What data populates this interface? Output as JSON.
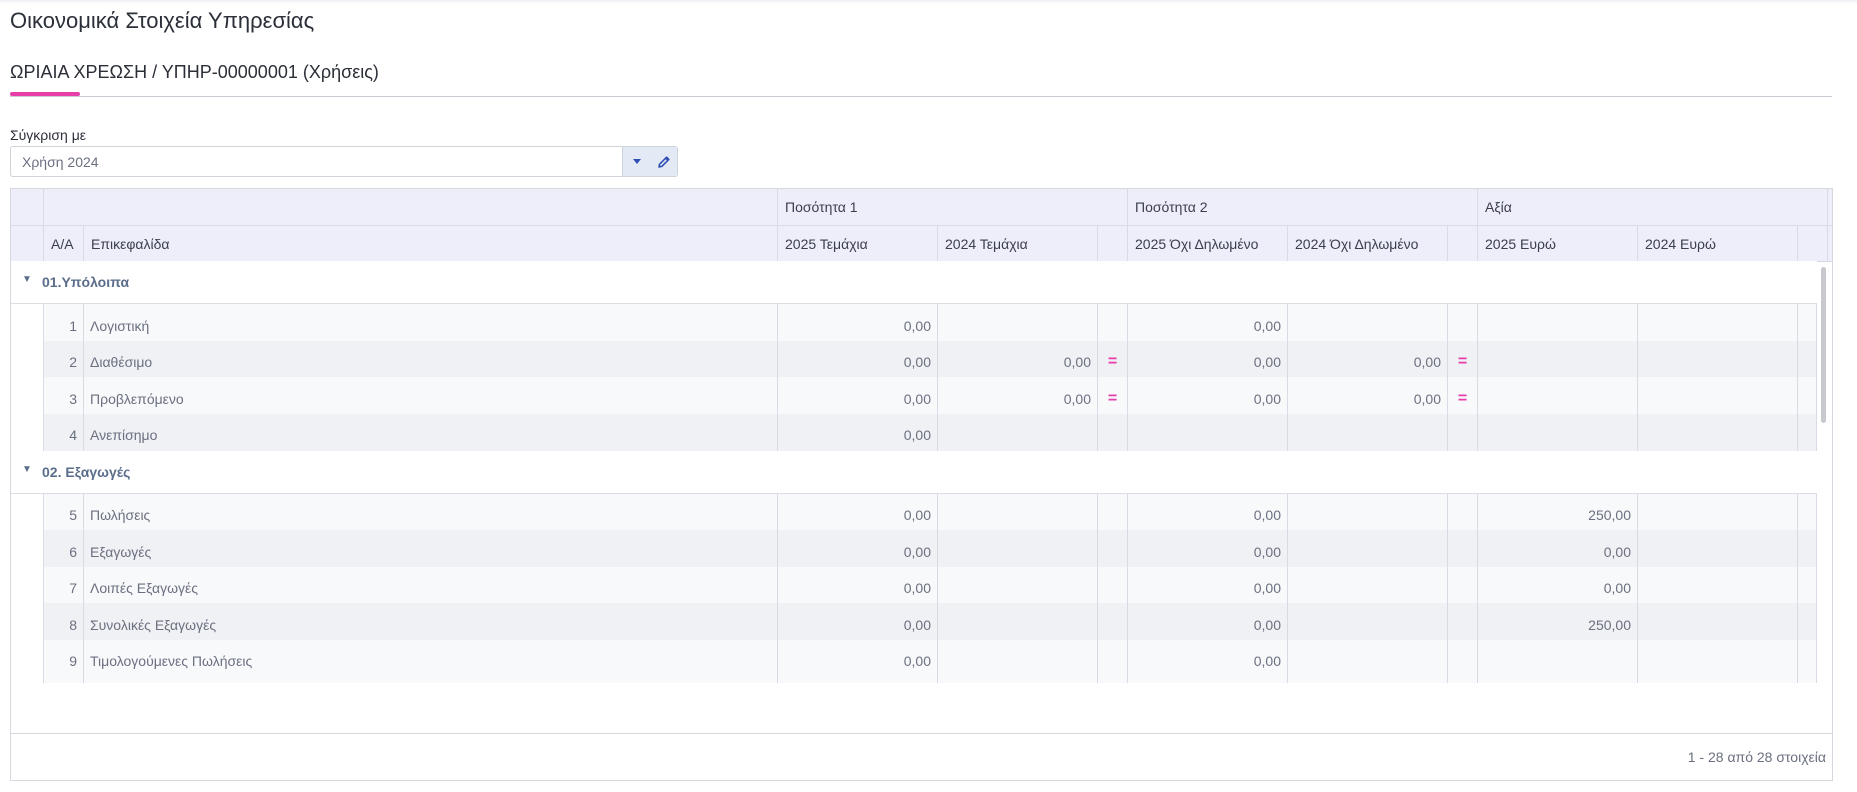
{
  "page": {
    "title": "Οικονομικά Στοιχεία Υπηρεσίας"
  },
  "tab": {
    "label": "ΩΡΙΑΙΑ ΧΡΕΩΣΗ / ΥΠΗΡ-00000001 (Χρήσεις)"
  },
  "compare": {
    "label": "Σύγκριση με",
    "value": "Χρήση 2024",
    "dropdown_icon": "caret-down-icon",
    "edit_icon": "pencil-icon"
  },
  "colors": {
    "accent": "#e73ea9",
    "header_bg": "#eeeefb",
    "link_blue": "#2f4fb3"
  },
  "grid": {
    "group_headers": {
      "g1": "Ποσότητα 1",
      "g2": "Ποσότητα 2",
      "g3": "Αξία"
    },
    "columns": {
      "aa": "Α/Α",
      "title": "Επικεφαλίδα",
      "q1_2025": "2025 Τεμάχια",
      "q1_2024": "2024 Τεμάχια",
      "q2_2025": "2025 Όχι Δηλωμένο",
      "q2_2024": "2024 Όχι Δηλωμένο",
      "v_2025": "2025 Ευρώ",
      "v_2024": "2024 Ευρώ"
    },
    "groups": [
      {
        "label": "01.Υπόλοιπα",
        "rows": [
          {
            "aa": "1",
            "title": "Λογιστική",
            "q1_2025": "0,00",
            "q1_2024": "",
            "eq1": "",
            "q2_2025": "0,00",
            "q2_2024": "",
            "eq2": "",
            "v_2025": "",
            "v_2024": ""
          },
          {
            "aa": "2",
            "title": "Διαθέσιμο",
            "q1_2025": "0,00",
            "q1_2024": "0,00",
            "eq1": "=",
            "q2_2025": "0,00",
            "q2_2024": "0,00",
            "eq2": "=",
            "v_2025": "",
            "v_2024": ""
          },
          {
            "aa": "3",
            "title": "Προβλεπόμενο",
            "q1_2025": "0,00",
            "q1_2024": "0,00",
            "eq1": "=",
            "q2_2025": "0,00",
            "q2_2024": "0,00",
            "eq2": "=",
            "v_2025": "",
            "v_2024": ""
          },
          {
            "aa": "4",
            "title": "Ανεπίσημο",
            "q1_2025": "0,00",
            "q1_2024": "",
            "eq1": "",
            "q2_2025": "",
            "q2_2024": "",
            "eq2": "",
            "v_2025": "",
            "v_2024": ""
          }
        ]
      },
      {
        "label": "02. Εξαγωγές",
        "rows": [
          {
            "aa": "5",
            "title": "Πωλήσεις",
            "q1_2025": "0,00",
            "q1_2024": "",
            "eq1": "",
            "q2_2025": "0,00",
            "q2_2024": "",
            "eq2": "",
            "v_2025": "250,00",
            "v_2024": ""
          },
          {
            "aa": "6",
            "title": "Εξαγωγές",
            "q1_2025": "0,00",
            "q1_2024": "",
            "eq1": "",
            "q2_2025": "0,00",
            "q2_2024": "",
            "eq2": "",
            "v_2025": "0,00",
            "v_2024": ""
          },
          {
            "aa": "7",
            "title": "Λοιπές Εξαγωγές",
            "q1_2025": "0,00",
            "q1_2024": "",
            "eq1": "",
            "q2_2025": "0,00",
            "q2_2024": "",
            "eq2": "",
            "v_2025": "0,00",
            "v_2024": ""
          },
          {
            "aa": "8",
            "title": "Συνολικές Εξαγωγές",
            "q1_2025": "0,00",
            "q1_2024": "",
            "eq1": "",
            "q2_2025": "0,00",
            "q2_2024": "",
            "eq2": "",
            "v_2025": "250,00",
            "v_2024": ""
          },
          {
            "aa": "9",
            "title": "Τιμολογούμενες Πωλήσεις",
            "q1_2025": "0,00",
            "q1_2024": "",
            "eq1": "",
            "q2_2025": "0,00",
            "q2_2024": "",
            "eq2": "",
            "v_2025": "",
            "v_2024": ""
          }
        ]
      }
    ],
    "footer": "1 - 28 από 28 στοιχεία"
  }
}
